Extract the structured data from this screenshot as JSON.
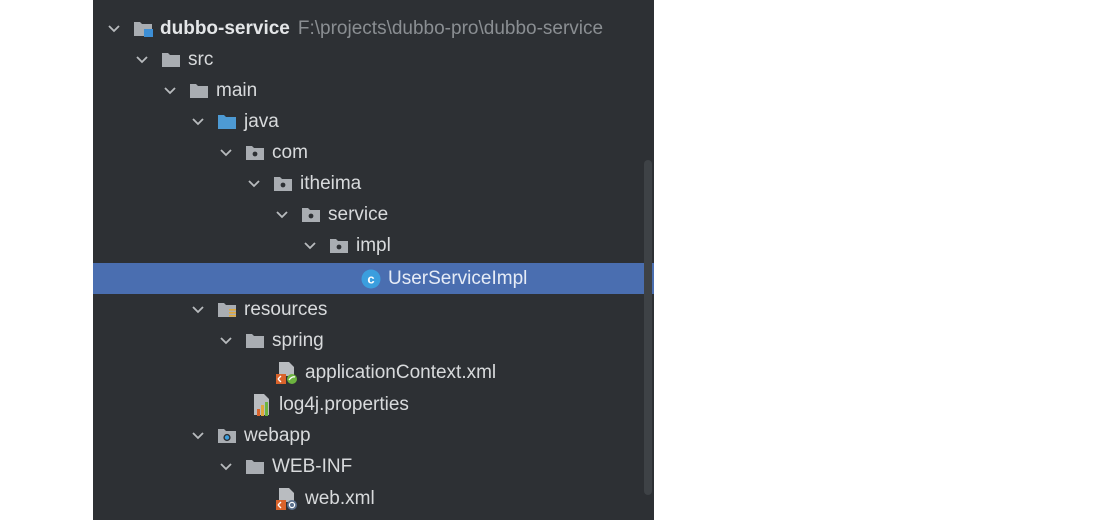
{
  "tree": {
    "root": {
      "label": "dubbo-service",
      "path": "F:\\projects\\dubbo-pro\\dubbo-service"
    },
    "rows": [
      {
        "label": "src"
      },
      {
        "label": "main"
      },
      {
        "label": "java"
      },
      {
        "label": "com"
      },
      {
        "label": "itheima"
      },
      {
        "label": "service"
      },
      {
        "label": "impl"
      },
      {
        "label": "UserServiceImpl"
      },
      {
        "label": "resources"
      },
      {
        "label": "spring"
      },
      {
        "label": "applicationContext.xml"
      },
      {
        "label": "log4j.properties"
      },
      {
        "label": "webapp"
      },
      {
        "label": "WEB-INF"
      },
      {
        "label": "web.xml"
      }
    ]
  },
  "colors": {
    "panel": "#2d3034",
    "selection": "#4a6eb0",
    "source_folder": "#4d9ad4",
    "class_icon": "#3b9ede"
  }
}
